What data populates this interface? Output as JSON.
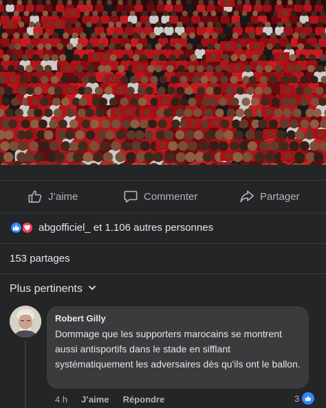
{
  "post": {
    "image_alt": "crowd-of-supporters-photo"
  },
  "actions": {
    "like_label": "J’aime",
    "comment_label": "Commenter",
    "share_label": "Partager"
  },
  "reactions": {
    "text": "abgofficiel_ et 1.106 autres personnes",
    "icons": [
      "like-icon",
      "love-icon"
    ],
    "like_color": "#2d88ff",
    "love_color": "#f33e58"
  },
  "shares": {
    "text": "153 partages"
  },
  "comments": {
    "sort_label": "Plus pertinents",
    "items": [
      {
        "author": "Robert Gilly",
        "text": "Dommage que les supporters marocains se montrent aussi antisportifs dans le stade en sifflant systématiquement les adversaires dès qu'ils ont le ballon.",
        "time": "4 h",
        "like_label": "J’aime",
        "reply_label": "Répondre",
        "reaction_count": "3"
      }
    ]
  },
  "colors": {
    "background": "#242526",
    "bubble": "#3a3b3c",
    "accent": "#2d88ff",
    "crowd_red": "#c8151b"
  }
}
